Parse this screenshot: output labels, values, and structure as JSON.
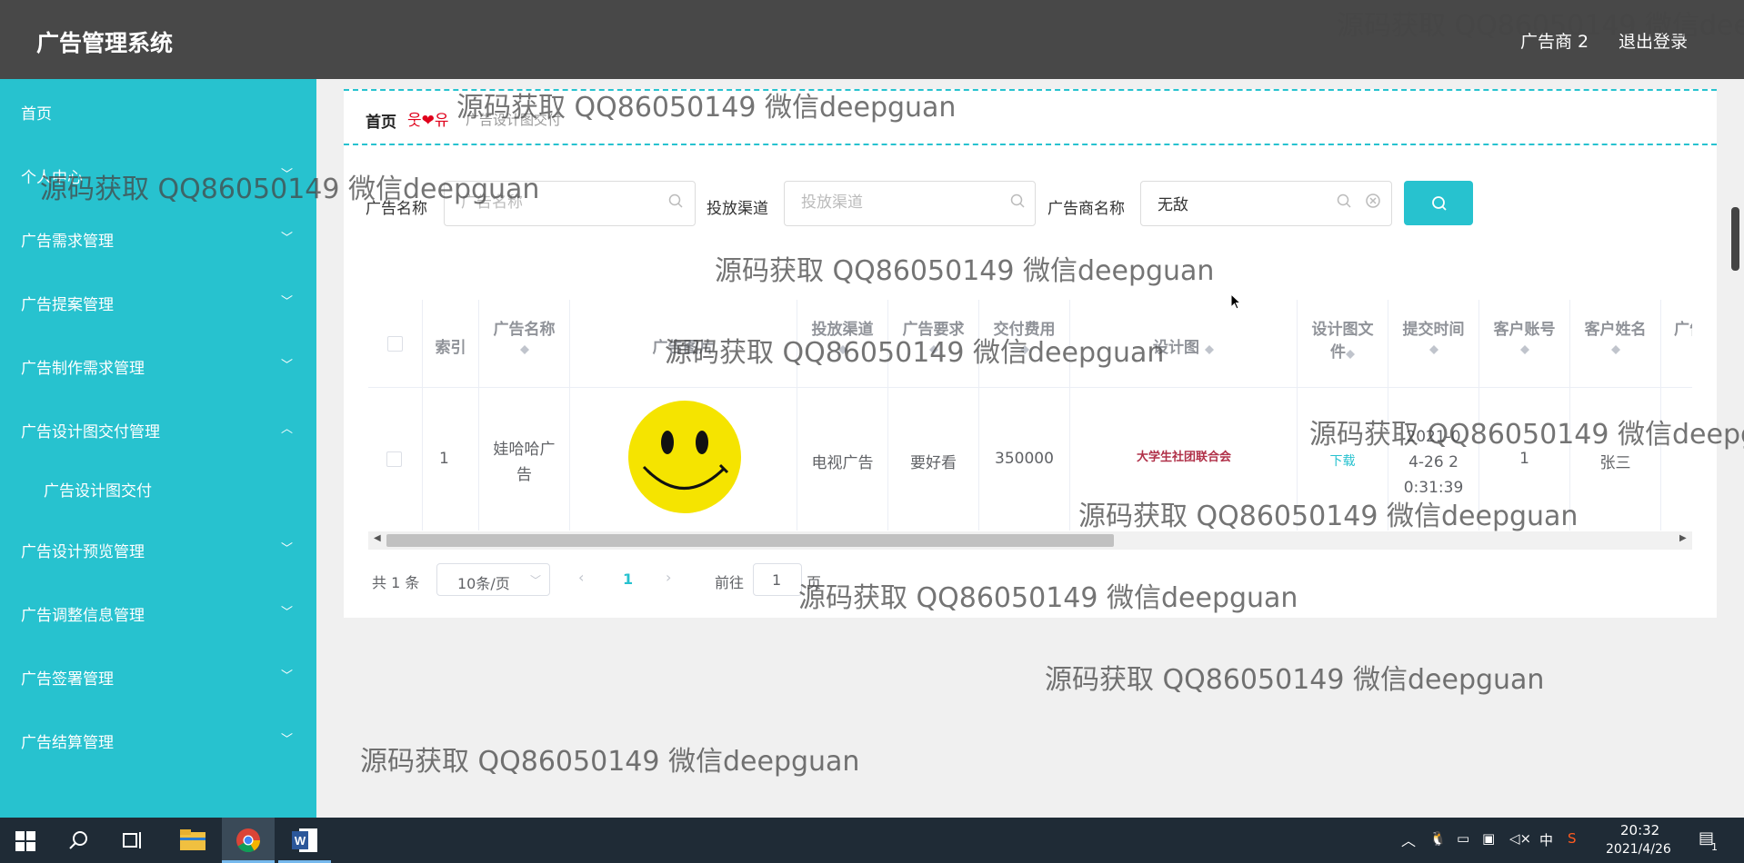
{
  "header": {
    "title": "广告管理系统",
    "user": "广告商 2",
    "logout": "退出登录"
  },
  "sidebar": {
    "items": [
      {
        "label": "首页"
      },
      {
        "label": "个人中心"
      },
      {
        "label": "广告需求管理"
      },
      {
        "label": "广告提案管理"
      },
      {
        "label": "广告制作需求管理"
      },
      {
        "label": "广告设计图交付管理"
      },
      {
        "label": "广告设计图交付"
      },
      {
        "label": "广告设计预览管理"
      },
      {
        "label": "广告调整信息管理"
      },
      {
        "label": "广告签署管理"
      },
      {
        "label": "广告结算管理"
      }
    ]
  },
  "breadcrumb": {
    "home": "首页",
    "decor": "웃❤유",
    "current": "广告设计图交付"
  },
  "search": {
    "ad_name_label": "广告名称",
    "ad_name_placeholder": "广告名称",
    "ad_name_value": "",
    "channel_label": "投放渠道",
    "channel_placeholder": "投放渠道",
    "channel_value": "",
    "advertiser_label": "广告商名称",
    "advertiser_value": "无敌"
  },
  "table": {
    "headers": [
      "索引",
      "广告名称",
      "广告图片",
      "投放渠道",
      "广告要求",
      "交付费用",
      "设计图",
      "设计图文件",
      "提交时间",
      "客户账号",
      "客户姓名",
      "广告号"
    ],
    "rows": [
      {
        "index": "1",
        "ad_name": "娃哈哈广告",
        "channel": "电视广告",
        "requirement": "要好看",
        "fee": "350000",
        "design_image_text": "大学生社团联合会",
        "design_file_link": "下载",
        "submit_time": "2021-04-26 20:31:39",
        "customer_account": "1",
        "customer_name": "张三"
      }
    ]
  },
  "pagination": {
    "total": "共 1 条",
    "page_size": "10条/页",
    "current": "1",
    "goto_label": "前往",
    "goto_value": "1",
    "page_suffix": "页"
  },
  "watermark": "源码获取 QQ86050149 微信deepguan",
  "taskbar": {
    "time": "20:32",
    "date": "2021/4/26",
    "ime": "中",
    "notif_count": "1"
  },
  "colors": {
    "accent": "#27c2cf",
    "header_bg": "#484848",
    "taskbar_bg": "#1f2b36"
  }
}
